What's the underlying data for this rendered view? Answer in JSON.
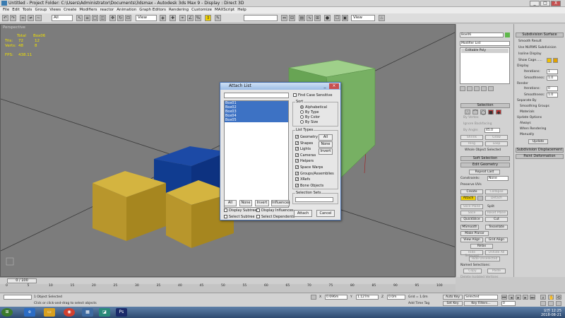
{
  "window": {
    "title": "Untitled    - Project Folder: C:\\Users\\Administrator\\Documents\\3dsmax    - Autodesk 3ds Max 9    - Display : Direct 3D",
    "buttons": {
      "minimize": "_",
      "maximize": "□",
      "close": "X"
    }
  },
  "menu": [
    "File",
    "Edit",
    "Tools",
    "Group",
    "Views",
    "Create",
    "Modifiers",
    "reactor",
    "Animation",
    "Graph Editors",
    "Rendering",
    "Customize",
    "MAXScript",
    "Help"
  ],
  "toolbar": {
    "selection_filter": "All",
    "ref_coord_1": "View",
    "ref_coord_2": "View",
    "named_sel": ""
  },
  "viewport": {
    "label": "Perspective",
    "stats": {
      "header_total": "Total",
      "header_obj": "Box06",
      "polys_label": "Tris:",
      "polys_total": "72",
      "polys_obj": "12",
      "verts_label": "Verts:",
      "verts_total": "48",
      "verts_obj": "8",
      "fps_label": "FPS:",
      "fps_value": "438.11"
    }
  },
  "dialog": {
    "title": "Attach List",
    "search_value": "",
    "find_case_sensitive": "Find Case Sensitive",
    "objects": [
      "Box01",
      "Box02",
      "Box03",
      "Box04",
      "Box05"
    ],
    "sort_title": "Sort",
    "sort_options": [
      "Alphabetical",
      "By Type",
      "By Color",
      "By Size"
    ],
    "sort_selected": "Alphabetical",
    "list_types_title": "List Types",
    "list_types": [
      "Geometry",
      "Shapes",
      "Lights",
      "Cameras",
      "Helpers",
      "Space Warps",
      "Groups/Assemblies",
      "XRefs",
      "Bone Objects"
    ],
    "list_btns": [
      "All",
      "None",
      "Invert"
    ],
    "selection_sets_title": "Selection Sets",
    "selection_sets_value": "",
    "bottom_btns": [
      "All",
      "None",
      "Invert",
      "Influences"
    ],
    "display_subtree": "Display Subtree",
    "display_influences": "Display Influences",
    "select_subtree": "Select Subtree",
    "select_dependents": "Select Dependents",
    "attach_label": "Attach",
    "cancel_label": "Cancel"
  },
  "command_panel": {
    "object_name": "Box06",
    "modifier_list": "Modifier List",
    "stack_item": "Editable Poly",
    "selection_rollout": "Selection",
    "by_vertex": "By Vertex",
    "ignore_backfacing": "Ignore Backfacing",
    "by_angle": "By Angle:",
    "by_angle_value": "45.0",
    "shrink": "Shrink",
    "grow": "Grow",
    "ring": "Ring",
    "loop": "Loop",
    "whole_object": "Whole Object Selected",
    "soft_selection": "Soft Selection",
    "edit_geometry": "Edit Geometry",
    "repeat_last": "Repeat Last",
    "constraints_label": "Constraints:",
    "constraints_value": "None",
    "preserve_uvs": "Preserve UVs",
    "create": "Create",
    "collapse": "Collapse",
    "attach": "Attach",
    "detach": "Detach",
    "slice_plane": "Slice Plane",
    "split": "Split",
    "slice": "Slice",
    "reset_plane": "Reset Plane",
    "quickslice": "QuickSlice",
    "cut": "Cut",
    "msmooth": "MSmooth",
    "tessellate": "Tessellate",
    "make_planar": "Make Planar",
    "view_align": "View Align",
    "grid_align": "Grid Align",
    "relax": "Relax",
    "hide_selected": "Hide Selected",
    "unhide_all": "Unhide All",
    "hide_unselected": "Hide Unselected",
    "named_selections": "Named Selections:",
    "copy": "Copy",
    "paste": "Paste",
    "delete_isolated": "Delete Isolated Vertices",
    "full_interactivity": "Full Interactivity"
  },
  "command_panel2": {
    "subdivision_surface": "Subdivision Surface",
    "smooth_result": "Smooth Result",
    "use_nurms": "Use NURMS Subdivision",
    "isoline_display": "Isoline Display",
    "show_cage": "Show Cage......",
    "display": "Display",
    "iterations_label": "Iterations:",
    "iterations_value": "1",
    "smoothness_label": "Smoothness:",
    "smoothness_value": "1.0",
    "render": "Render",
    "r_iterations_label": "Iterations:",
    "r_iterations_value": "0",
    "r_smoothness_label": "Smoothness:",
    "r_smoothness_value": "1.0",
    "separate_by": "Separate By",
    "smoothing_groups": "Smoothing Groups",
    "materials": "Materials",
    "update_options": "Update Options",
    "always": "Always",
    "when_rendering": "When Rendering",
    "manually": "Manually",
    "update": "Update",
    "subdivision_displacement": "Subdivision Displacement",
    "paint_deformation": "Paint Deformation"
  },
  "timeline": {
    "frame_display": "0 / 100",
    "ticks": [
      "0",
      "5",
      "10",
      "15",
      "20",
      "25",
      "30",
      "35",
      "40",
      "45",
      "50",
      "55",
      "60",
      "65",
      "70",
      "75",
      "80",
      "85",
      "90",
      "95",
      "100"
    ]
  },
  "status": {
    "selection": "1 Object Selected",
    "prompt": "Click or click-and-drag to select objects",
    "x_value": "0.696m",
    "y_value": "1.127m",
    "z_value": "0.0m",
    "grid": "Grid = 1.0m",
    "add_time_tag": "Add Time Tag",
    "auto_key": "Auto Key",
    "set_key": "Set Key",
    "selected": "Selected",
    "key_filters": "Key Filters...",
    "frame": "0"
  },
  "taskbar": {
    "time": "오전 12:25",
    "date": "2018-08-21"
  }
}
